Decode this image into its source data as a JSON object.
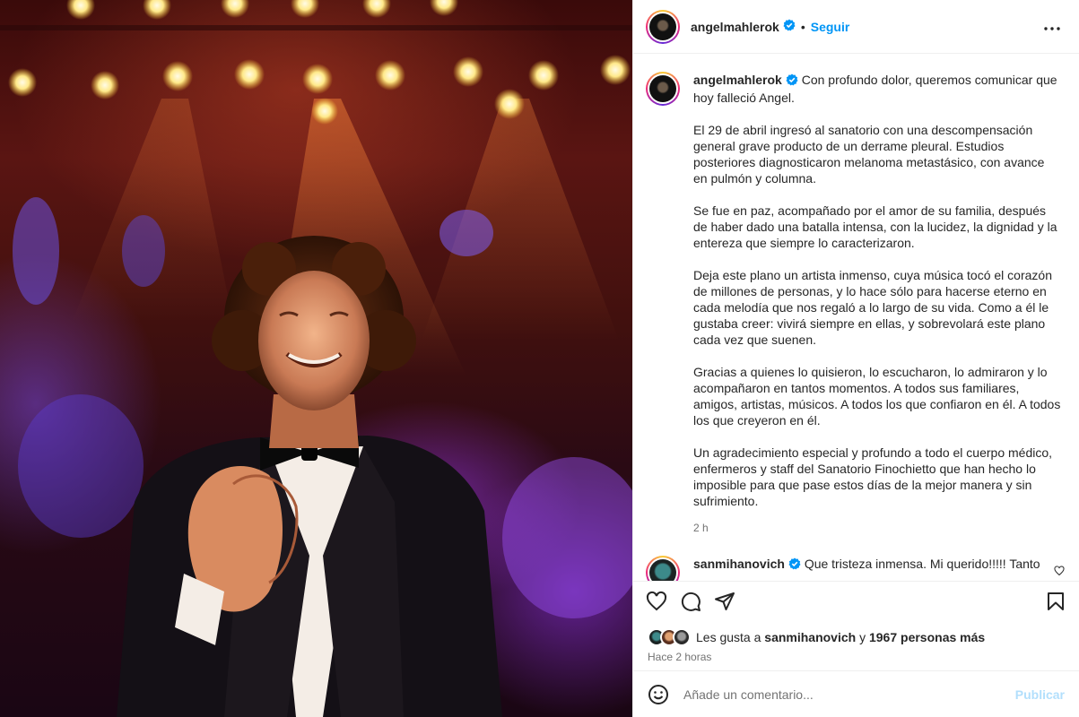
{
  "photo": {
    "alt_name": "post-photo"
  },
  "header": {
    "username": "angelmahlerok",
    "separator": "•",
    "follow_label": "Seguir"
  },
  "caption": {
    "username": "angelmahlerok",
    "paragraph_1": "Con profundo dolor, queremos comunicar que hoy falleció Angel.",
    "paragraph_2": "El 29 de abril ingresó al sanatorio con una descompensación general grave producto de un derrame pleural. Estudios posteriores diagnosticaron melanoma metastásico, con avance en pulmón y columna.",
    "paragraph_3": "Se fue en paz, acompañado por el amor de su familia, después de haber dado una batalla intensa, con la lucidez, la dignidad y la entereza que siempre lo caracterizaron.",
    "paragraph_4": "Deja este plano un artista inmenso, cuya música tocó el corazón de millones de personas, y lo hace sólo para hacerse eterno en cada melodía que nos regaló a lo largo de su vida. Como a él le gustaba creer: vivirá siempre en ellas, y sobrevolará este plano cada vez que suenen.",
    "paragraph_5": "Gracias a quienes lo quisieron, lo escucharon, lo admiraron y lo acompañaron en tantos momentos. A todos sus familiares, amigos, artistas, músicos. A todos los que confiaron en él. A todos los que creyeron en él.",
    "paragraph_6": "Un agradecimiento especial y profundo a todo el cuerpo médico, enfermeros y staff del Sanatorio Finochietto que han hecho lo imposible para que pase estos días de la mejor manera y sin sufrimiento.",
    "time": "2 h"
  },
  "comment": {
    "username": "sanmihanovich",
    "text": "Que tristeza inmensa. Mi querido!!!!! Tanto compartimos!!! Tanto disfrutamos!!!! Abrazo fuerte a"
  },
  "likes": {
    "prefix": "Les gusta a",
    "user": "sanmihanovich",
    "conjunction": "y",
    "others": "1967 personas más"
  },
  "posted_ago": "Hace 2 horas",
  "add_comment": {
    "placeholder": "Añade un comentario...",
    "publish_label": "Publicar"
  },
  "colors": {
    "accent": "#0095f6",
    "publish_disabled": "#b2dffc",
    "secondary_text": "#737373"
  },
  "icons": {
    "verified": "verified-badge-icon",
    "more": "more-options-icon",
    "like": "heart-icon",
    "comment": "comment-bubble-icon",
    "share": "paper-plane-icon",
    "save": "bookmark-icon",
    "emoji": "emoji-icon"
  }
}
